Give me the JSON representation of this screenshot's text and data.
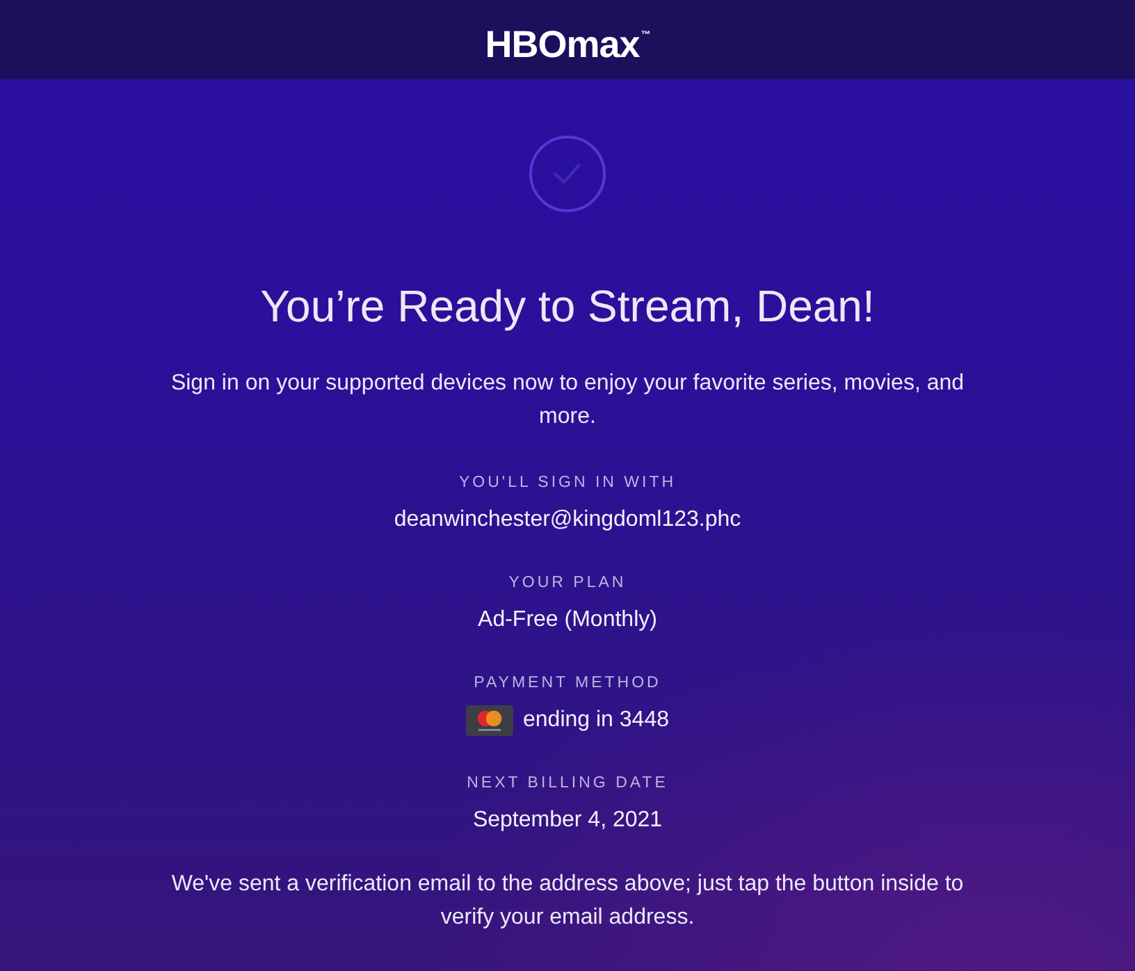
{
  "header": {
    "logo": "HBOmax$^{™}$"
  },
  "confirmation": {
    "title": "You’re Ready to Stream, Dean!",
    "message": "Sign in on your supported devices now to enjoy your favorite series, movies, and more."
  },
  "details": [
    {
      "kind": "text",
      "label": "YOU'LL SIGN IN WITH",
      "value": "deanwinchester@kingdoml123.phc"
    },
    {
      "kind": "text",
      "label": "YOUR PLAN",
      "value": "Ad-Free (Monthly)"
    },
    {
      "kind": "card",
      "label": "PAYMENT METHOD",
      "value": "ending in 3448"
    },
    {
      "kind": "text",
      "label": "NEXT BILLING DATE",
      "value": "September 4, 2021"
    }
  ],
  "notice": "We've sent a verification email to the address above; just tap the button inside to verify your email address."
}
